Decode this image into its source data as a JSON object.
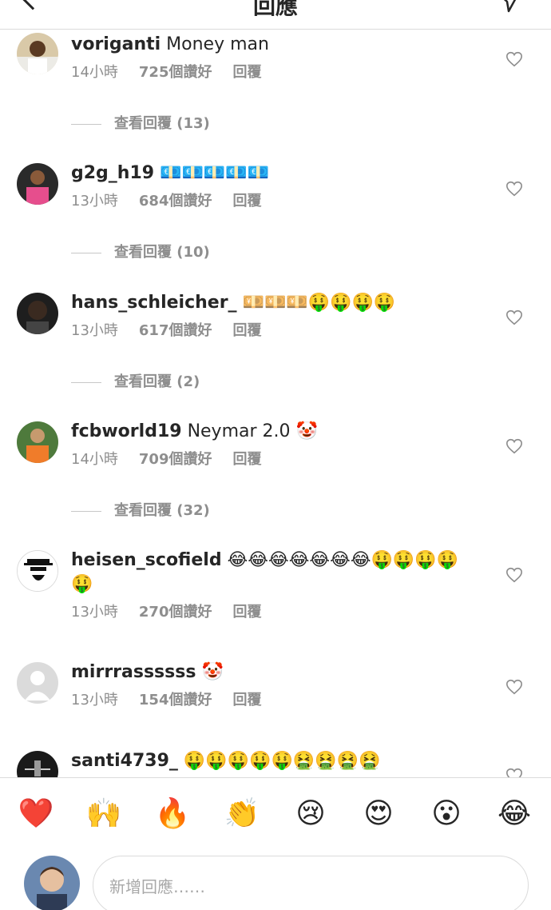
{
  "header": {
    "title": "回應"
  },
  "comments": [
    {
      "username": "voriganti",
      "text": "Money man",
      "time": "14小時",
      "likes": "725個讚好",
      "reply_label": "回覆",
      "view_replies": "查看回覆 (13)"
    },
    {
      "username": "g2g_h19",
      "text": "💶💶💶💶💶",
      "time": "13小時",
      "likes": "684個讚好",
      "reply_label": "回覆",
      "view_replies": "查看回覆 (10)"
    },
    {
      "username": "hans_schleicher_",
      "text": "💴💴💴🤑🤑🤑🤑",
      "time": "13小時",
      "likes": "617個讚好",
      "reply_label": "回覆",
      "view_replies": "查看回覆 (2)"
    },
    {
      "username": "fcbworld19",
      "text": "Neymar 2.0 🤡",
      "time": "14小時",
      "likes": "709個讚好",
      "reply_label": "回覆",
      "view_replies": "查看回覆 (32)"
    },
    {
      "username": "heisen_scofield",
      "text": "😂😂😂😂😂😂😂🤑🤑🤑🤑🤑",
      "time": "13小時",
      "likes": "270個讚好",
      "reply_label": "回覆"
    },
    {
      "username": "mirrrassssss",
      "text": "🤡",
      "time": "13小時",
      "likes": "154個讚好",
      "reply_label": "回覆"
    },
    {
      "username": "santi4739_",
      "text": "🤑🤑🤑🤑🤑🤮🤮🤮🤮"
    }
  ],
  "reactions": [
    "❤️",
    "🙌",
    "🔥",
    "👏",
    "😢",
    "😍",
    "😮",
    "😂"
  ],
  "composer": {
    "placeholder": "新增回應……"
  },
  "icons": {
    "back": "chevron-left-icon",
    "send": "send-icon",
    "like": "heart-outline-icon"
  }
}
